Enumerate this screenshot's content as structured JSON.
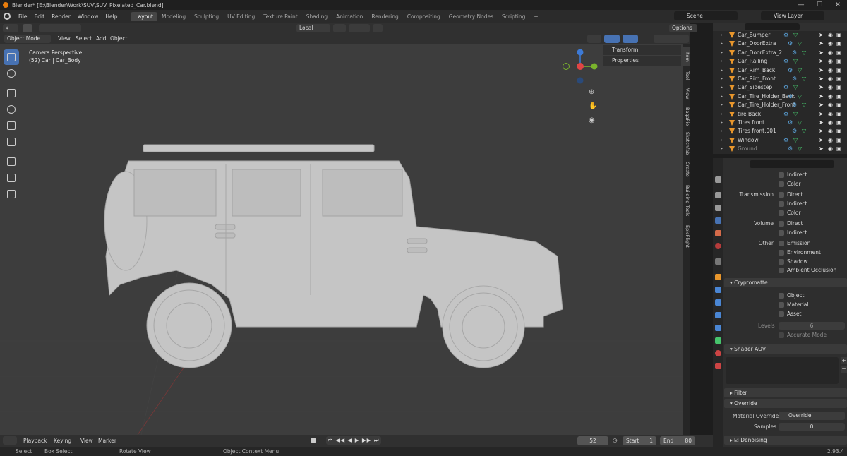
{
  "titlebar": {
    "title": "Blender* [E:\\Blender\\Work\\SUV\\SUV_Pixelated_Car.blend]",
    "minimize": "—",
    "maximize": "☐",
    "close": "✕"
  },
  "topbar": {
    "menus": [
      "File",
      "Edit",
      "Render",
      "Window",
      "Help"
    ],
    "workspaces": [
      "Layout",
      "Modeling",
      "Sculpting",
      "UV Editing",
      "Texture Paint",
      "Shading",
      "Animation",
      "Rendering",
      "Compositing",
      "Geometry Nodes",
      "Scripting"
    ],
    "active_workspace": "Layout",
    "add_tab": "+",
    "scene": "Scene",
    "view_layer": "View Layer"
  },
  "viewport_header": {
    "mode": "Object Mode",
    "menus": [
      "View",
      "Select",
      "Add",
      "Object"
    ],
    "transform_orientation": "Local",
    "options": "Options"
  },
  "viewport": {
    "camera_label": "Camera Perspective",
    "object_label": "(52) Car | Car_Body",
    "npanel": [
      "Transform",
      "Properties"
    ],
    "sidebar_tabs": [
      "Item",
      "Tool",
      "View",
      "BagaPie",
      "Sketchfab",
      "Create",
      "Building Tools",
      "EpicFlight"
    ],
    "gizmo_axes": [
      "X",
      "Y",
      "Z"
    ]
  },
  "outliner": {
    "search_placeholder": "",
    "items": [
      {
        "name": "Car_Bumper"
      },
      {
        "name": "Car_DoorExtra"
      },
      {
        "name": "Car_DoorExtra_2"
      },
      {
        "name": "Car_Railing"
      },
      {
        "name": "Car_Rim_Back"
      },
      {
        "name": "Car_Rim_Front"
      },
      {
        "name": "Car_Sidestep"
      },
      {
        "name": "Car_Tire_Holder_Back"
      },
      {
        "name": "Car_Tire_Holder_Front"
      },
      {
        "name": "tire Back"
      },
      {
        "name": "Tires front"
      },
      {
        "name": "Tires front.001"
      },
      {
        "name": "Window"
      },
      {
        "name": "Ground"
      }
    ]
  },
  "properties": {
    "rows": [
      {
        "group": "",
        "label": "Indirect",
        "checked": false
      },
      {
        "group": "",
        "label": "Color",
        "checked": false
      },
      {
        "group": "Transmission",
        "label": "Direct",
        "checked": false
      },
      {
        "group": "",
        "label": "Indirect",
        "checked": false
      },
      {
        "group": "",
        "label": "Color",
        "checked": false
      },
      {
        "group": "Volume",
        "label": "Direct",
        "checked": false
      },
      {
        "group": "",
        "label": "Indirect",
        "checked": false
      },
      {
        "group": "Other",
        "label": "Emission",
        "checked": false
      },
      {
        "group": "",
        "label": "Environment",
        "checked": false
      },
      {
        "group": "",
        "label": "Shadow",
        "checked": false
      },
      {
        "group": "",
        "label": "Ambient Occlusion",
        "checked": false
      }
    ],
    "cryptomatte": {
      "title": "Cryptomatte",
      "rows": [
        {
          "label": "Object",
          "checked": false
        },
        {
          "label": "Material",
          "checked": false
        },
        {
          "label": "Asset",
          "checked": false
        }
      ],
      "levels_label": "Levels",
      "levels_value": "6",
      "accurate_mode": "Accurate Mode"
    },
    "shader_aov": "Shader AOV",
    "filter": "Filter",
    "override": "Override",
    "material_override_label": "Material Override",
    "material_override_value": "Override",
    "samples_label": "Samples",
    "samples_value": "0",
    "denoising": "Denoising"
  },
  "timeline": {
    "menus": [
      "Playback",
      "Keying",
      "View",
      "Marker"
    ],
    "current_frame": "52",
    "start_label": "Start",
    "start_value": "1",
    "end_label": "End",
    "end_value": "80"
  },
  "statusbar": {
    "select": "Select",
    "box_select": "Box Select",
    "rotate_view": "Rotate View",
    "context_menu": "Object Context Menu",
    "version": "2.93.4"
  }
}
